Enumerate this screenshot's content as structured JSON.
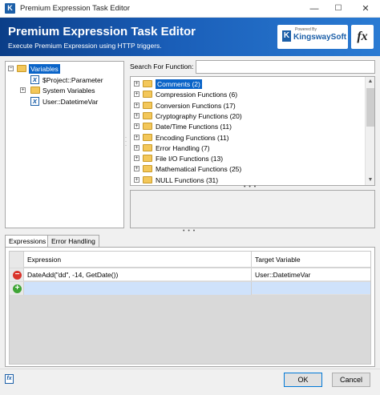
{
  "window": {
    "title": "Premium Expression Task Editor",
    "minimize": "—",
    "maximize": "☐",
    "close": "✕"
  },
  "banner": {
    "title": "Premium Expression Task Editor",
    "subtitle": "Execute Premium Expression using HTTP triggers.",
    "logo_powered": "Powered By",
    "logo_name": "KingswaySoft",
    "fx": "fx"
  },
  "variables_tree": {
    "root": "Variables",
    "items": [
      {
        "label": "$Project::Parameter",
        "icon": "variable-icon"
      },
      {
        "label": "System Variables",
        "icon": "folder-icon"
      },
      {
        "label": "User::DatetimeVar",
        "icon": "variable-icon"
      }
    ]
  },
  "search": {
    "label": "Search For Function:",
    "value": ""
  },
  "functions": [
    {
      "label": "Comments (2)",
      "selected": true
    },
    {
      "label": "Compression Functions (6)"
    },
    {
      "label": "Conversion Functions (17)"
    },
    {
      "label": "Cryptography Functions (20)"
    },
    {
      "label": "Date/Time Functions (11)"
    },
    {
      "label": "Encoding Functions (11)"
    },
    {
      "label": "Error Handling (7)"
    },
    {
      "label": "File I/O Functions (13)"
    },
    {
      "label": "Mathematical Functions (25)"
    },
    {
      "label": "NULL Functions (31)"
    }
  ],
  "tabs": [
    "Expressions",
    "Error Handling"
  ],
  "grid": {
    "headers": [
      "Expression",
      "Target Variable"
    ],
    "rows": [
      {
        "expression": "DateAdd(\"dd\", -14, GetDate())",
        "target": "User::DatetimeVar"
      }
    ]
  },
  "buttons": {
    "ok": "OK",
    "cancel": "Cancel"
  },
  "colors": {
    "accent": "#0a64c8",
    "banner": "#1a5eb8",
    "remove": "#d9342b",
    "add": "#3fa535"
  }
}
